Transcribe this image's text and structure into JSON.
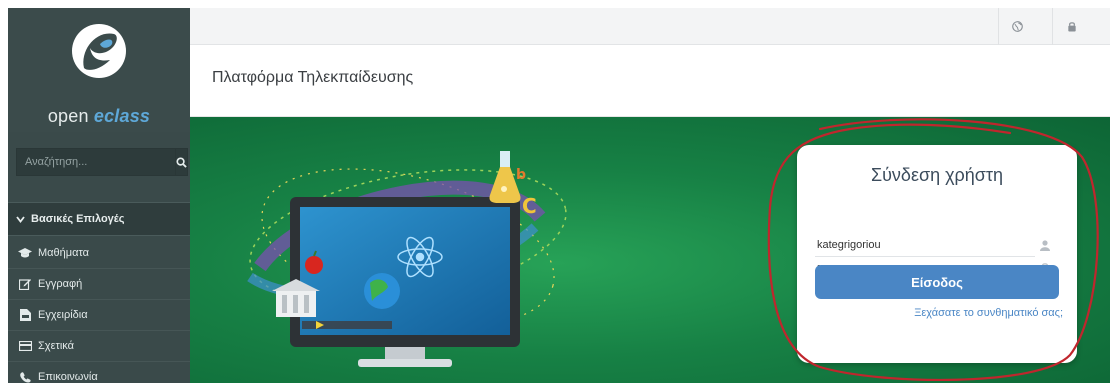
{
  "brand": {
    "name_prefix": "open ",
    "name_accent": "eclass"
  },
  "search": {
    "placeholder": "Αναζήτηση..."
  },
  "sidebar": {
    "section_title": "Βασικές Επιλογές",
    "items": [
      {
        "label": "Μαθήματα",
        "icon": "graduation-cap-icon"
      },
      {
        "label": "Εγγραφή",
        "icon": "edit-icon"
      },
      {
        "label": "Εγχειρίδια",
        "icon": "file-pdf-icon"
      },
      {
        "label": "Σχετικά",
        "icon": "credit-card-icon"
      },
      {
        "label": "Επικοινωνία",
        "icon": "phone-icon"
      }
    ]
  },
  "topbar": {
    "icons": [
      "globe-icon",
      "lock-icon"
    ]
  },
  "header": {
    "title": "Πλατφόρμα Τηλεκπαίδευσης"
  },
  "login": {
    "title": "Σύνδεση χρήστη",
    "username_value": "kategrigoriou",
    "password_value": "••••••••••••••",
    "submit_label": "Είσοδος",
    "forgot_label": "Ξεχάσατε το συνθηματικό σας;"
  },
  "colors": {
    "sidebar_bg": "#3a4a4a",
    "hero_green": "#178145",
    "accent_blue": "#4a86c5",
    "annotation_red": "#c0262d"
  }
}
